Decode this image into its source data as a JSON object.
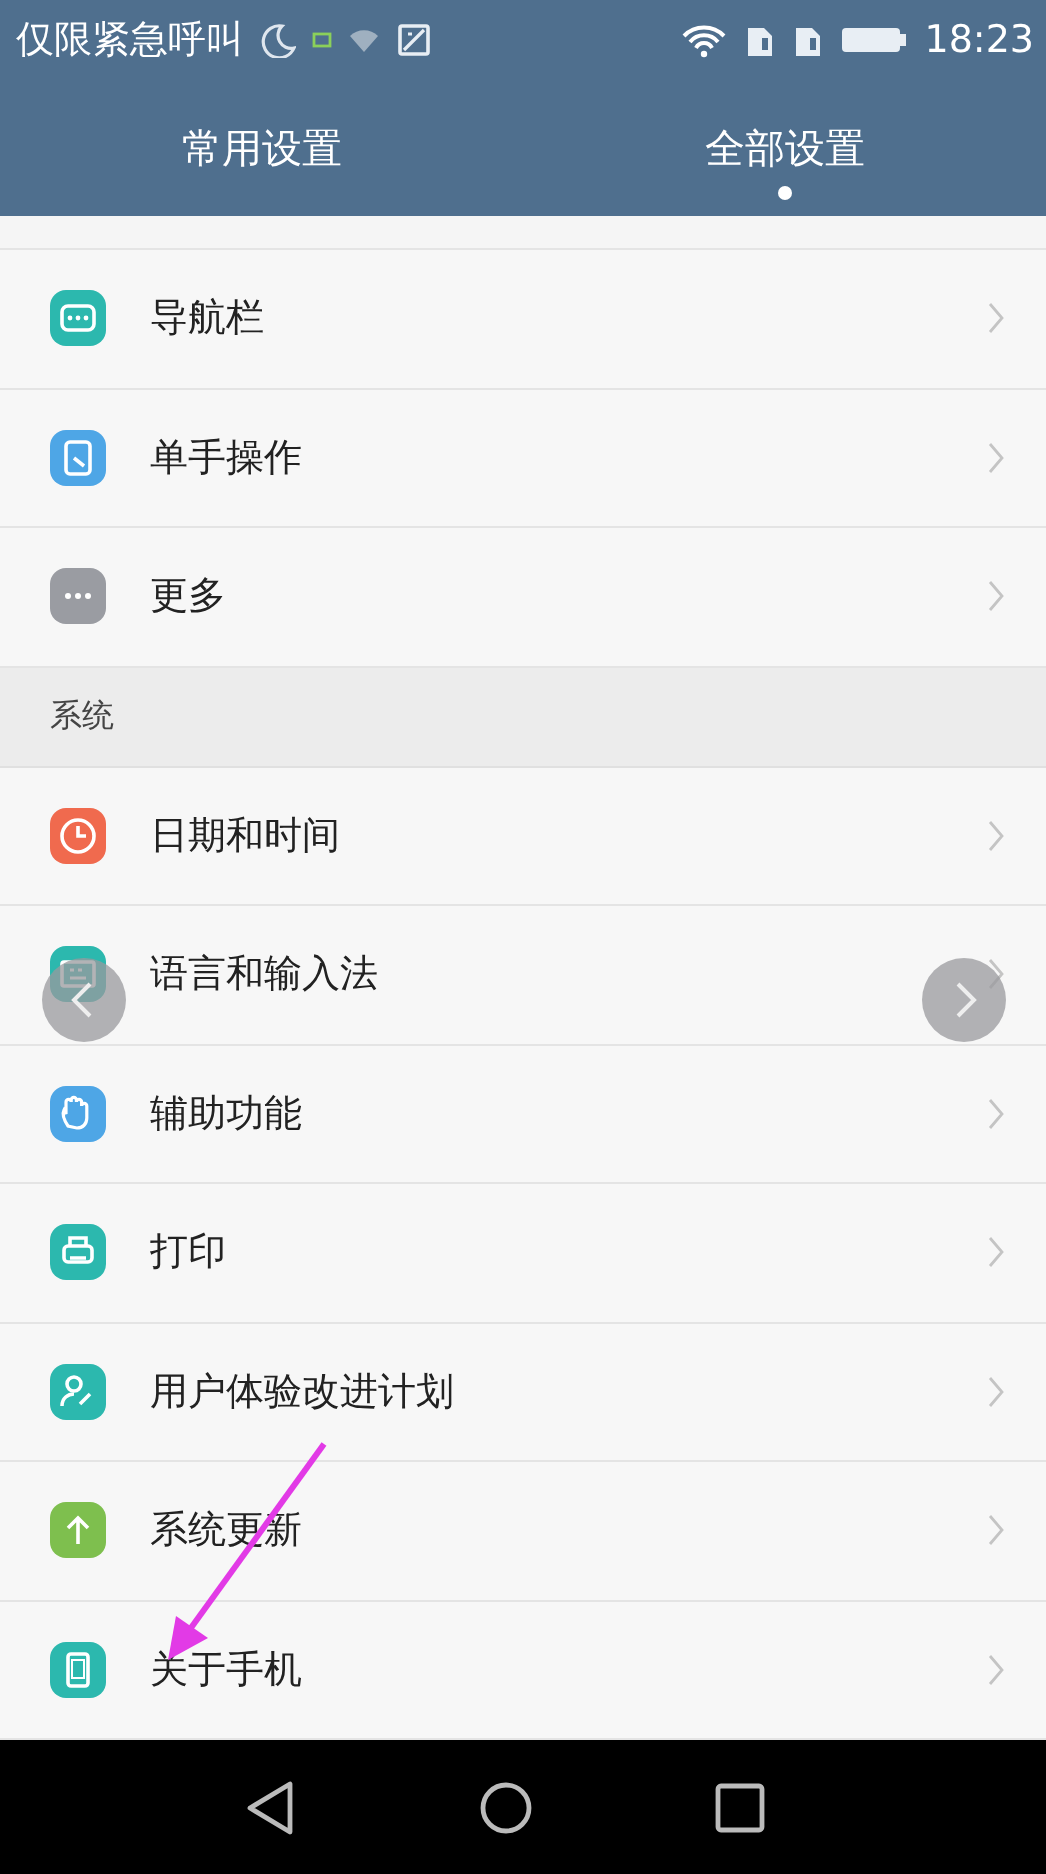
{
  "status_bar": {
    "carrier": "仅限紧急呼叫",
    "time": "18:23"
  },
  "tabs": [
    {
      "label": "常用设置",
      "selected": false
    },
    {
      "label": "全部设置",
      "selected": true
    }
  ],
  "sections": [
    {
      "items": [
        {
          "label": "导航栏",
          "color": "#2cb8ae"
        },
        {
          "label": "单手操作",
          "color": "#4ea6e6"
        },
        {
          "label": "更多",
          "color": "#9a9ca2"
        }
      ]
    },
    {
      "header": "系统",
      "items": [
        {
          "label": "日期和时间",
          "color": "#f06a4e"
        },
        {
          "label": "语言和输入法",
          "color": "#2cb8ae"
        },
        {
          "label": "辅助功能",
          "color": "#4ea6e6"
        },
        {
          "label": "打印",
          "color": "#2cb8ae"
        },
        {
          "label": "用户体验改进计划",
          "color": "#2cb8ae"
        },
        {
          "label": "系统更新",
          "color": "#7ebf4e"
        },
        {
          "label": "关于手机",
          "color": "#2cb8ae"
        }
      ]
    }
  ]
}
